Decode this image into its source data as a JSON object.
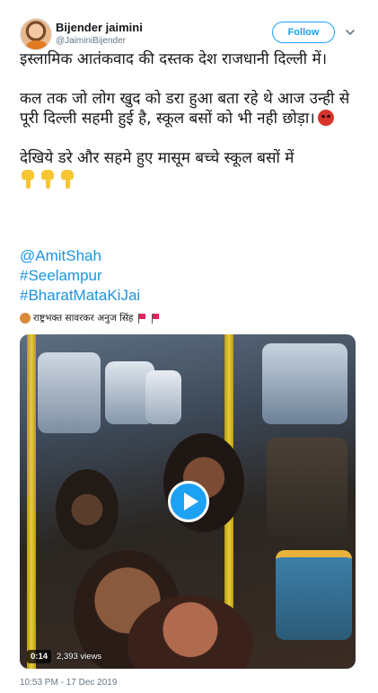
{
  "author": {
    "display_name": "Bijender jaimini",
    "handle": "@JaiminiBijender"
  },
  "follow_button": {
    "label": "Follow"
  },
  "tweet": {
    "paragraphs": [
      "इस्लामिक आतंकवाद की दस्तक देश राजधानी दिल्ली में।",
      "कल तक जो लोग खुद को डरा हुआ बता रहे थे आज उन्ही से पूरी दिल्ली सहमी हुई है, स्कूल बसों को भी नही छोड़ा।",
      "देखिये डरे और सहमे हुए मासूम बच्चे स्कूल बसों में"
    ],
    "emojis": [
      "angry-face-emoji",
      "pointing-down-emoji",
      "pointing-down-emoji",
      "pointing-down-emoji"
    ],
    "mention": "@AmitShah",
    "hashtags": [
      "#Seelampur",
      "#BharatMataKiJai"
    ],
    "signature": "राष्ट्रभक्त सावरकर अनुज सिंह"
  },
  "video": {
    "duration": "0:14",
    "views": "2,393 views"
  },
  "timestamp": "10:53 PM - 17 Dec 2019",
  "colors": {
    "accent": "#1da1f2",
    "link": "#1b95e0",
    "muted": "#657786"
  }
}
